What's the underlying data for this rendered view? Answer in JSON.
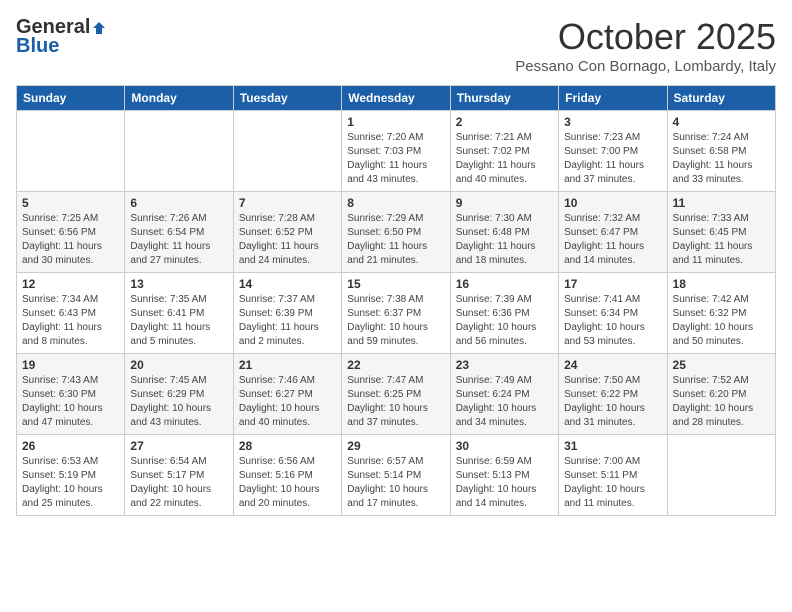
{
  "logo": {
    "general": "General",
    "blue": "Blue"
  },
  "title": {
    "month": "October 2025",
    "location": "Pessano Con Bornago, Lombardy, Italy"
  },
  "headers": [
    "Sunday",
    "Monday",
    "Tuesday",
    "Wednesday",
    "Thursday",
    "Friday",
    "Saturday"
  ],
  "weeks": [
    [
      {
        "day": "",
        "sunrise": "",
        "sunset": "",
        "daylight": ""
      },
      {
        "day": "",
        "sunrise": "",
        "sunset": "",
        "daylight": ""
      },
      {
        "day": "",
        "sunrise": "",
        "sunset": "",
        "daylight": ""
      },
      {
        "day": "1",
        "sunrise": "Sunrise: 7:20 AM",
        "sunset": "Sunset: 7:03 PM",
        "daylight": "Daylight: 11 hours and 43 minutes."
      },
      {
        "day": "2",
        "sunrise": "Sunrise: 7:21 AM",
        "sunset": "Sunset: 7:02 PM",
        "daylight": "Daylight: 11 hours and 40 minutes."
      },
      {
        "day": "3",
        "sunrise": "Sunrise: 7:23 AM",
        "sunset": "Sunset: 7:00 PM",
        "daylight": "Daylight: 11 hours and 37 minutes."
      },
      {
        "day": "4",
        "sunrise": "Sunrise: 7:24 AM",
        "sunset": "Sunset: 6:58 PM",
        "daylight": "Daylight: 11 hours and 33 minutes."
      }
    ],
    [
      {
        "day": "5",
        "sunrise": "Sunrise: 7:25 AM",
        "sunset": "Sunset: 6:56 PM",
        "daylight": "Daylight: 11 hours and 30 minutes."
      },
      {
        "day": "6",
        "sunrise": "Sunrise: 7:26 AM",
        "sunset": "Sunset: 6:54 PM",
        "daylight": "Daylight: 11 hours and 27 minutes."
      },
      {
        "day": "7",
        "sunrise": "Sunrise: 7:28 AM",
        "sunset": "Sunset: 6:52 PM",
        "daylight": "Daylight: 11 hours and 24 minutes."
      },
      {
        "day": "8",
        "sunrise": "Sunrise: 7:29 AM",
        "sunset": "Sunset: 6:50 PM",
        "daylight": "Daylight: 11 hours and 21 minutes."
      },
      {
        "day": "9",
        "sunrise": "Sunrise: 7:30 AM",
        "sunset": "Sunset: 6:48 PM",
        "daylight": "Daylight: 11 hours and 18 minutes."
      },
      {
        "day": "10",
        "sunrise": "Sunrise: 7:32 AM",
        "sunset": "Sunset: 6:47 PM",
        "daylight": "Daylight: 11 hours and 14 minutes."
      },
      {
        "day": "11",
        "sunrise": "Sunrise: 7:33 AM",
        "sunset": "Sunset: 6:45 PM",
        "daylight": "Daylight: 11 hours and 11 minutes."
      }
    ],
    [
      {
        "day": "12",
        "sunrise": "Sunrise: 7:34 AM",
        "sunset": "Sunset: 6:43 PM",
        "daylight": "Daylight: 11 hours and 8 minutes."
      },
      {
        "day": "13",
        "sunrise": "Sunrise: 7:35 AM",
        "sunset": "Sunset: 6:41 PM",
        "daylight": "Daylight: 11 hours and 5 minutes."
      },
      {
        "day": "14",
        "sunrise": "Sunrise: 7:37 AM",
        "sunset": "Sunset: 6:39 PM",
        "daylight": "Daylight: 11 hours and 2 minutes."
      },
      {
        "day": "15",
        "sunrise": "Sunrise: 7:38 AM",
        "sunset": "Sunset: 6:37 PM",
        "daylight": "Daylight: 10 hours and 59 minutes."
      },
      {
        "day": "16",
        "sunrise": "Sunrise: 7:39 AM",
        "sunset": "Sunset: 6:36 PM",
        "daylight": "Daylight: 10 hours and 56 minutes."
      },
      {
        "day": "17",
        "sunrise": "Sunrise: 7:41 AM",
        "sunset": "Sunset: 6:34 PM",
        "daylight": "Daylight: 10 hours and 53 minutes."
      },
      {
        "day": "18",
        "sunrise": "Sunrise: 7:42 AM",
        "sunset": "Sunset: 6:32 PM",
        "daylight": "Daylight: 10 hours and 50 minutes."
      }
    ],
    [
      {
        "day": "19",
        "sunrise": "Sunrise: 7:43 AM",
        "sunset": "Sunset: 6:30 PM",
        "daylight": "Daylight: 10 hours and 47 minutes."
      },
      {
        "day": "20",
        "sunrise": "Sunrise: 7:45 AM",
        "sunset": "Sunset: 6:29 PM",
        "daylight": "Daylight: 10 hours and 43 minutes."
      },
      {
        "day": "21",
        "sunrise": "Sunrise: 7:46 AM",
        "sunset": "Sunset: 6:27 PM",
        "daylight": "Daylight: 10 hours and 40 minutes."
      },
      {
        "day": "22",
        "sunrise": "Sunrise: 7:47 AM",
        "sunset": "Sunset: 6:25 PM",
        "daylight": "Daylight: 10 hours and 37 minutes."
      },
      {
        "day": "23",
        "sunrise": "Sunrise: 7:49 AM",
        "sunset": "Sunset: 6:24 PM",
        "daylight": "Daylight: 10 hours and 34 minutes."
      },
      {
        "day": "24",
        "sunrise": "Sunrise: 7:50 AM",
        "sunset": "Sunset: 6:22 PM",
        "daylight": "Daylight: 10 hours and 31 minutes."
      },
      {
        "day": "25",
        "sunrise": "Sunrise: 7:52 AM",
        "sunset": "Sunset: 6:20 PM",
        "daylight": "Daylight: 10 hours and 28 minutes."
      }
    ],
    [
      {
        "day": "26",
        "sunrise": "Sunrise: 6:53 AM",
        "sunset": "Sunset: 5:19 PM",
        "daylight": "Daylight: 10 hours and 25 minutes."
      },
      {
        "day": "27",
        "sunrise": "Sunrise: 6:54 AM",
        "sunset": "Sunset: 5:17 PM",
        "daylight": "Daylight: 10 hours and 22 minutes."
      },
      {
        "day": "28",
        "sunrise": "Sunrise: 6:56 AM",
        "sunset": "Sunset: 5:16 PM",
        "daylight": "Daylight: 10 hours and 20 minutes."
      },
      {
        "day": "29",
        "sunrise": "Sunrise: 6:57 AM",
        "sunset": "Sunset: 5:14 PM",
        "daylight": "Daylight: 10 hours and 17 minutes."
      },
      {
        "day": "30",
        "sunrise": "Sunrise: 6:59 AM",
        "sunset": "Sunset: 5:13 PM",
        "daylight": "Daylight: 10 hours and 14 minutes."
      },
      {
        "day": "31",
        "sunrise": "Sunrise: 7:00 AM",
        "sunset": "Sunset: 5:11 PM",
        "daylight": "Daylight: 10 hours and 11 minutes."
      },
      {
        "day": "",
        "sunrise": "",
        "sunset": "",
        "daylight": ""
      }
    ]
  ]
}
